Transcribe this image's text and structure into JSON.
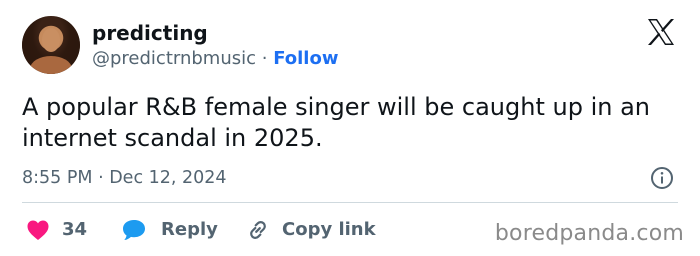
{
  "author": {
    "display_name": "predicting",
    "handle": "@predictrnbmusic",
    "separator": " · ",
    "follow_label": "Follow"
  },
  "tweet": {
    "text": "A popular R&B female singer will be caught up in an internet scandal in 2025.",
    "timestamp": "8:55 PM · Dec 12, 2024"
  },
  "actions": {
    "like_count": "34",
    "reply_label": "Reply",
    "copy_link_label": "Copy link"
  },
  "watermark": "boredpanda.com",
  "colors": {
    "accent": "#1d6ff2",
    "like": "#f91880",
    "reply": "#1d9bf0",
    "text": "#0f1419",
    "secondary": "#536471"
  },
  "icons": [
    "avatar",
    "x-logo-icon",
    "info-icon",
    "heart-icon",
    "speech-bubble-icon",
    "link-icon"
  ]
}
